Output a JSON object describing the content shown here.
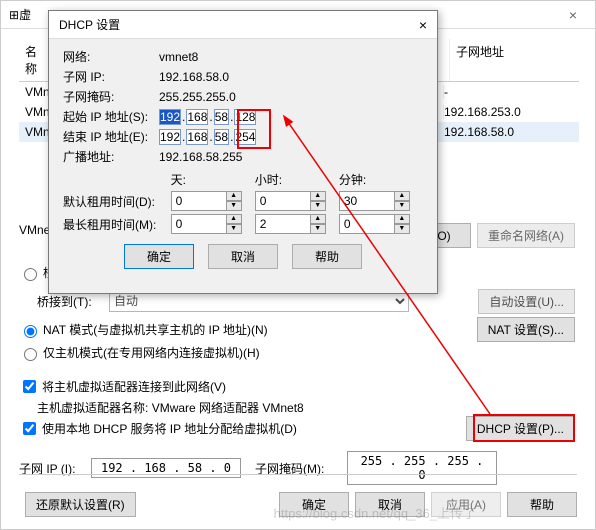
{
  "main": {
    "title_prefix": "虚",
    "close": "×",
    "name_header": "名称",
    "subnet_header": "子网地址",
    "rows": [
      {
        "name": "VMnet",
        "subnet": "-"
      },
      {
        "name": "VMnet",
        "subnet": "192.168.253.0"
      },
      {
        "name": "VMnet",
        "subnet": "192.168.58.0"
      }
    ],
    "vmnet_label": "VMnet",
    "add_net_btn": "络(O)",
    "rename_btn": "重命名网络(A)",
    "bridged_radio": "桥",
    "bridged_to": "桥接到(T):",
    "auto_opt": "自动",
    "auto_set_btn": "自动设置(U)...",
    "nat_radio": "NAT 模式(与虚拟机共享主机的 IP 地址)(N)",
    "nat_set_btn": "NAT 设置(S)...",
    "host_radio": "仅主机模式(在专用网络内连接虚拟机)(H)",
    "chk_host_adapter": "将主机虚拟适配器连接到此网络(V)",
    "host_adapter_name_lbl": "主机虚拟适配器名称:",
    "host_adapter_name": "VMware 网络适配器 VMnet8",
    "chk_dhcp": "使用本地 DHCP 服务将 IP 地址分配给虚拟机(D)",
    "dhcp_set_btn": "DHCP 设置(P)...",
    "subnet_ip_lbl": "子网 IP (I):",
    "subnet_ip": "192 . 168 . 58 . 0",
    "subnet_mask_lbl": "子网掩码(M):",
    "subnet_mask": "255 . 255 . 255 . 0",
    "restore_btn": "还原默认设置(R)",
    "ok": "确定",
    "cancel": "取消",
    "apply": "应用(A)",
    "help": "帮助"
  },
  "dlg": {
    "title": "DHCP 设置",
    "close": "×",
    "network_lbl": "网络:",
    "network": "vmnet8",
    "subnet_ip_lbl": "子网 IP:",
    "subnet_ip": "192.168.58.0",
    "mask_lbl": "子网掩码:",
    "mask": "255.255.255.0",
    "start_lbl": "起始 IP 地址(S):",
    "start_ip": [
      "192",
      "168",
      "58",
      "128"
    ],
    "end_lbl": "结束 IP 地址(E):",
    "end_ip": [
      "192",
      "168",
      "58",
      "254"
    ],
    "bcast_lbl": "广播地址:",
    "bcast": "192.168.58.255",
    "days": "天:",
    "hours": "小时:",
    "mins": "分钟:",
    "def_lease_lbl": "默认租用时间(D):",
    "def_lease": [
      "0",
      "0",
      "30"
    ],
    "max_lease_lbl": "最长租用时间(M):",
    "max_lease": [
      "0",
      "2",
      "0"
    ],
    "ok": "确定",
    "cancel": "取消",
    "help": "帮助"
  },
  "watermark": "https://blog.csdn.net/qq_36_上传了"
}
